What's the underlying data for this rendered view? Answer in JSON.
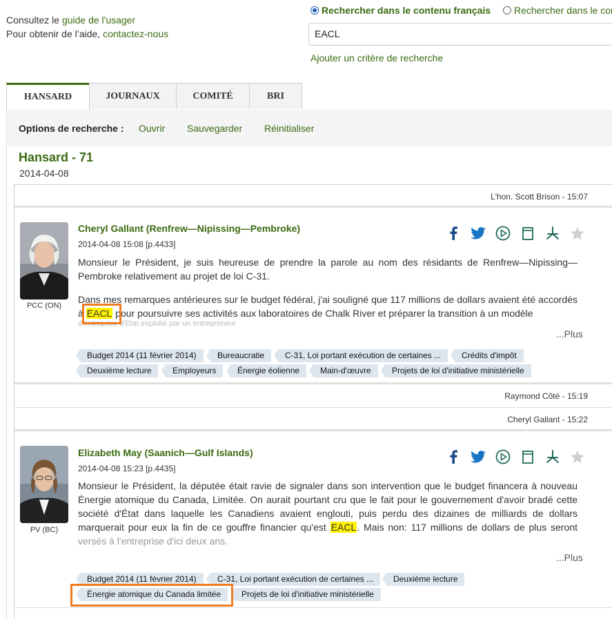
{
  "help": {
    "line1_prefix": "Consultez le ",
    "line1_link": "guide de l'usager",
    "line2_prefix": "Pour obtenir de l’aide, ",
    "line2_link": "contactez-nous"
  },
  "search": {
    "radio_fr": "Rechercher dans le contenu français",
    "radio_other": "Rechercher dans le conte",
    "query": "EACL",
    "add_criterion": "Ajouter un critère de recherche"
  },
  "tabs": [
    {
      "label": "HANSARD"
    },
    {
      "label": "JOURNAUX"
    },
    {
      "label": "COMITÉ"
    },
    {
      "label": "BRI"
    }
  ],
  "options": {
    "label": "Options de recherche :",
    "open": "Ouvrir",
    "save": "Sauvegarder",
    "reset": "Réinitialiser"
  },
  "hansard": {
    "title": "Hansard - 71",
    "date": "2014-04-08"
  },
  "speakers": {
    "s1": "L'hon. Scott Brison - 15:07",
    "s2": "Raymond Côté - 15:19",
    "s3": "Cheryl Gallant - 15:22"
  },
  "colors": {
    "accent_green": "#3b6b12",
    "highlight_yellow": "#fff200",
    "tag_bg": "#dde6ef",
    "orange_box": "#f07c22"
  },
  "cards": [
    {
      "name": "Cheryl Gallant (Renfrew—Nipissing—Pembroke)",
      "meta": "2014-04-08 15:08 [p.4433]",
      "party": "PCC (ON)",
      "para1": "Monsieur le Président, je suis heureuse de prendre la parole au nom des résidants de Renfrew—Nipissing—Pembroke relativement au projet de loi C-31.",
      "para2_a": "Dans mes remarques antérieures sur le budget fédéral, j'ai souligné que 117 millions de dollars avaient été accordés à ",
      "para2_hl": "EACL",
      "para2_b": " pour poursuivre ses activités aux laboratoires de Chalk River et préparer la transition à un modèle",
      "para2_fade": "d'entreprise d'État exploité par un entrepreneur",
      "more": "...Plus",
      "tags": [
        "Budget 2014 (11 février 2014)",
        "Bureaucratie",
        "C-31, Loi portant exécution de certaines ...",
        "Crédits d'impôt",
        "Deuxième lecture",
        "Employeurs",
        "Énergie éolienne",
        "Main-d'œuvre",
        "Projets de loi d'initiative ministérielle"
      ]
    },
    {
      "name": "Elizabeth May (Saanich—Gulf Islands)",
      "meta": "2014-04-08 15:23 [p.4435]",
      "party": "PV (BC)",
      "para1_a": "Monsieur le Président, la députée était ravie de signaler dans son intervention que le budget financera à nouveau Énergie atomique du Canada, Limitée. On aurait pourtant cru que le fait pour le gouvernement d'avoir bradé cette société d'État dans laquelle les Canadiens avaient englouti, puis perdu des dizaines de milliards de dollars marquerait pour eux la fin de ce gouffre financier qu'est ",
      "para1_hl": "EACL",
      "para1_b": ". Mais non: 117 millions de dollars de plus seront ",
      "para1_fade": "versés à l'entreprise d'ici deux ans.",
      "more": "...Plus",
      "tags": [
        "Budget 2014 (11 février 2014)",
        "C-31, Loi portant exécution de certaines ...",
        "Deuxième lecture",
        "Énergie atomique du Canada limitée",
        "Projets de loi d'initiative ministérielle"
      ]
    }
  ],
  "icons": [
    "facebook-icon",
    "twitter-icon",
    "play-icon",
    "bookmark-icon",
    "pdf-icon",
    "star-icon"
  ]
}
